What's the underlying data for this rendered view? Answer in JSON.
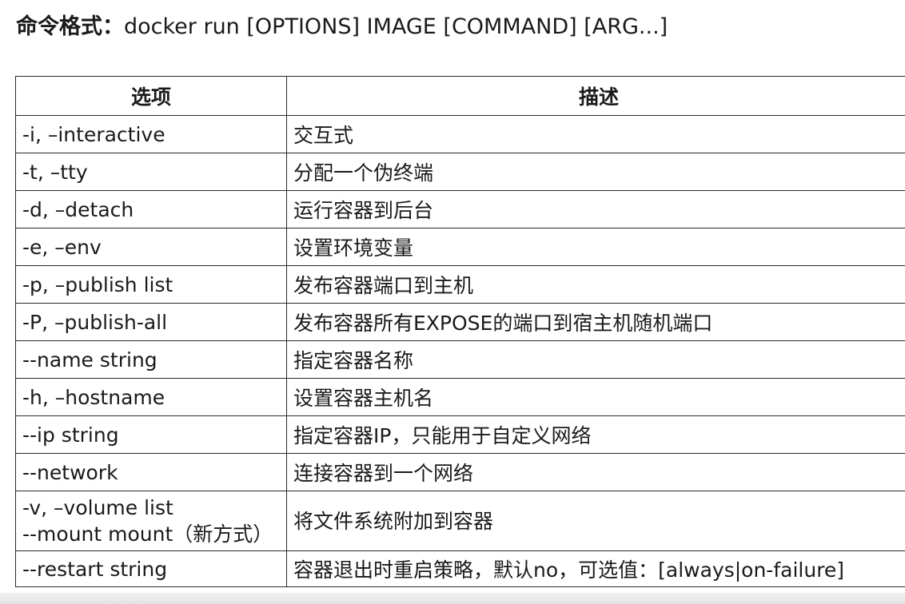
{
  "header": {
    "label": "命令格式：",
    "syntax": "docker run [OPTIONS] IMAGE [COMMAND] [ARG...]"
  },
  "table": {
    "headers": [
      "选项",
      "描述"
    ],
    "rows": [
      {
        "option": "-i, –interactive",
        "desc": "交互式"
      },
      {
        "option": "-t, –tty",
        "desc": "分配一个伪终端"
      },
      {
        "option": "-d, –detach",
        "desc": "运行容器到后台"
      },
      {
        "option": "-e, –env",
        "desc": "设置环境变量"
      },
      {
        "option": "-p, –publish list",
        "desc": "发布容器端口到主机"
      },
      {
        "option": "-P, –publish-all",
        "desc": "发布容器所有EXPOSE的端口到宿主机随机端口"
      },
      {
        "option": "--name string",
        "desc": "指定容器名称"
      },
      {
        "option": "-h, –hostname",
        "desc": "设置容器主机名"
      },
      {
        "option": "--ip string",
        "desc": "指定容器IP，只能用于自定义网络"
      },
      {
        "option": "--network",
        "desc": "连接容器到一个网络"
      },
      {
        "option": "-v, –volume list",
        "option_line2": "--mount mount（新方式）",
        "desc": "将文件系统附加到容器"
      },
      {
        "option": "--restart string",
        "desc": "容器退出时重启策略，默认no，可选值：[always|on-failure]"
      }
    ]
  }
}
